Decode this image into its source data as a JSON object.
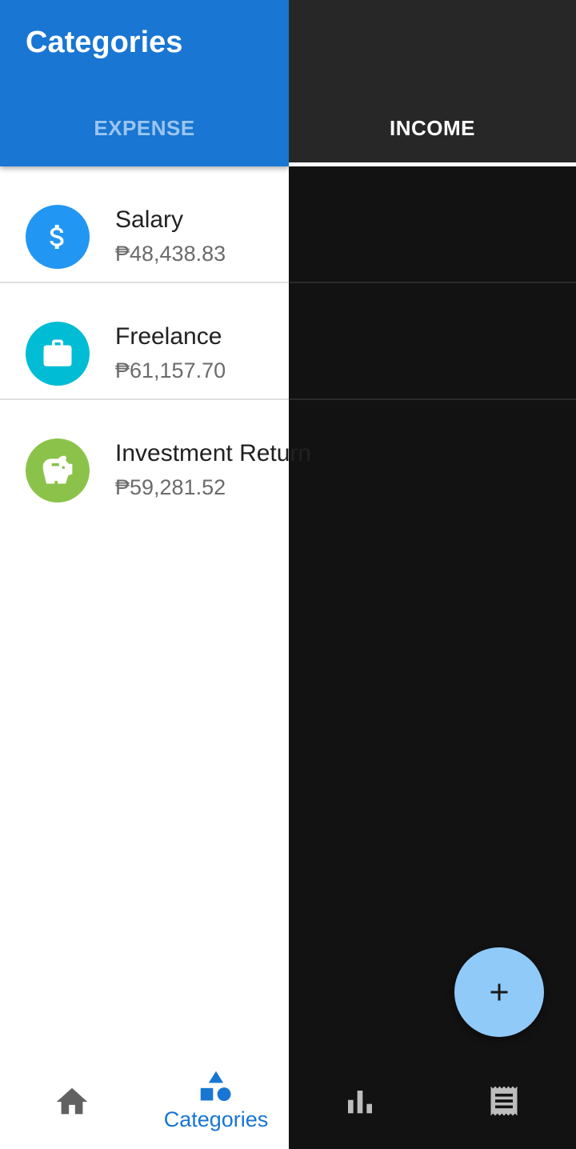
{
  "app_bar": {
    "title": "Categories",
    "tabs": [
      {
        "label": "EXPENSE",
        "selected": false
      },
      {
        "label": "INCOME",
        "selected": true
      }
    ]
  },
  "categories": [
    {
      "name": "Salary",
      "amount": "₱48,438.83",
      "icon": "dollar-icon",
      "color": "#2196f3"
    },
    {
      "name": "Freelance",
      "amount": "₱61,157.70",
      "icon": "briefcase-icon",
      "color": "#00bcd4"
    },
    {
      "name": "Investment Return",
      "amount": "₱59,281.52",
      "icon": "piggy-bank-icon",
      "color": "#8bc34a"
    }
  ],
  "fab": {
    "icon": "plus-icon"
  },
  "bottom_nav": {
    "items": [
      {
        "icon": "home-icon",
        "label": "",
        "active": false
      },
      {
        "icon": "shapes-icon",
        "label": "Categories",
        "active": true
      },
      {
        "icon": "bar-chart-icon",
        "label": "",
        "active": false
      },
      {
        "icon": "receipt-icon",
        "label": "",
        "active": false
      }
    ]
  },
  "colors": {
    "primary": "#1976d2",
    "dark_surface": "#121212",
    "dark_appbar": "#272727",
    "fab": "#90caf9"
  }
}
